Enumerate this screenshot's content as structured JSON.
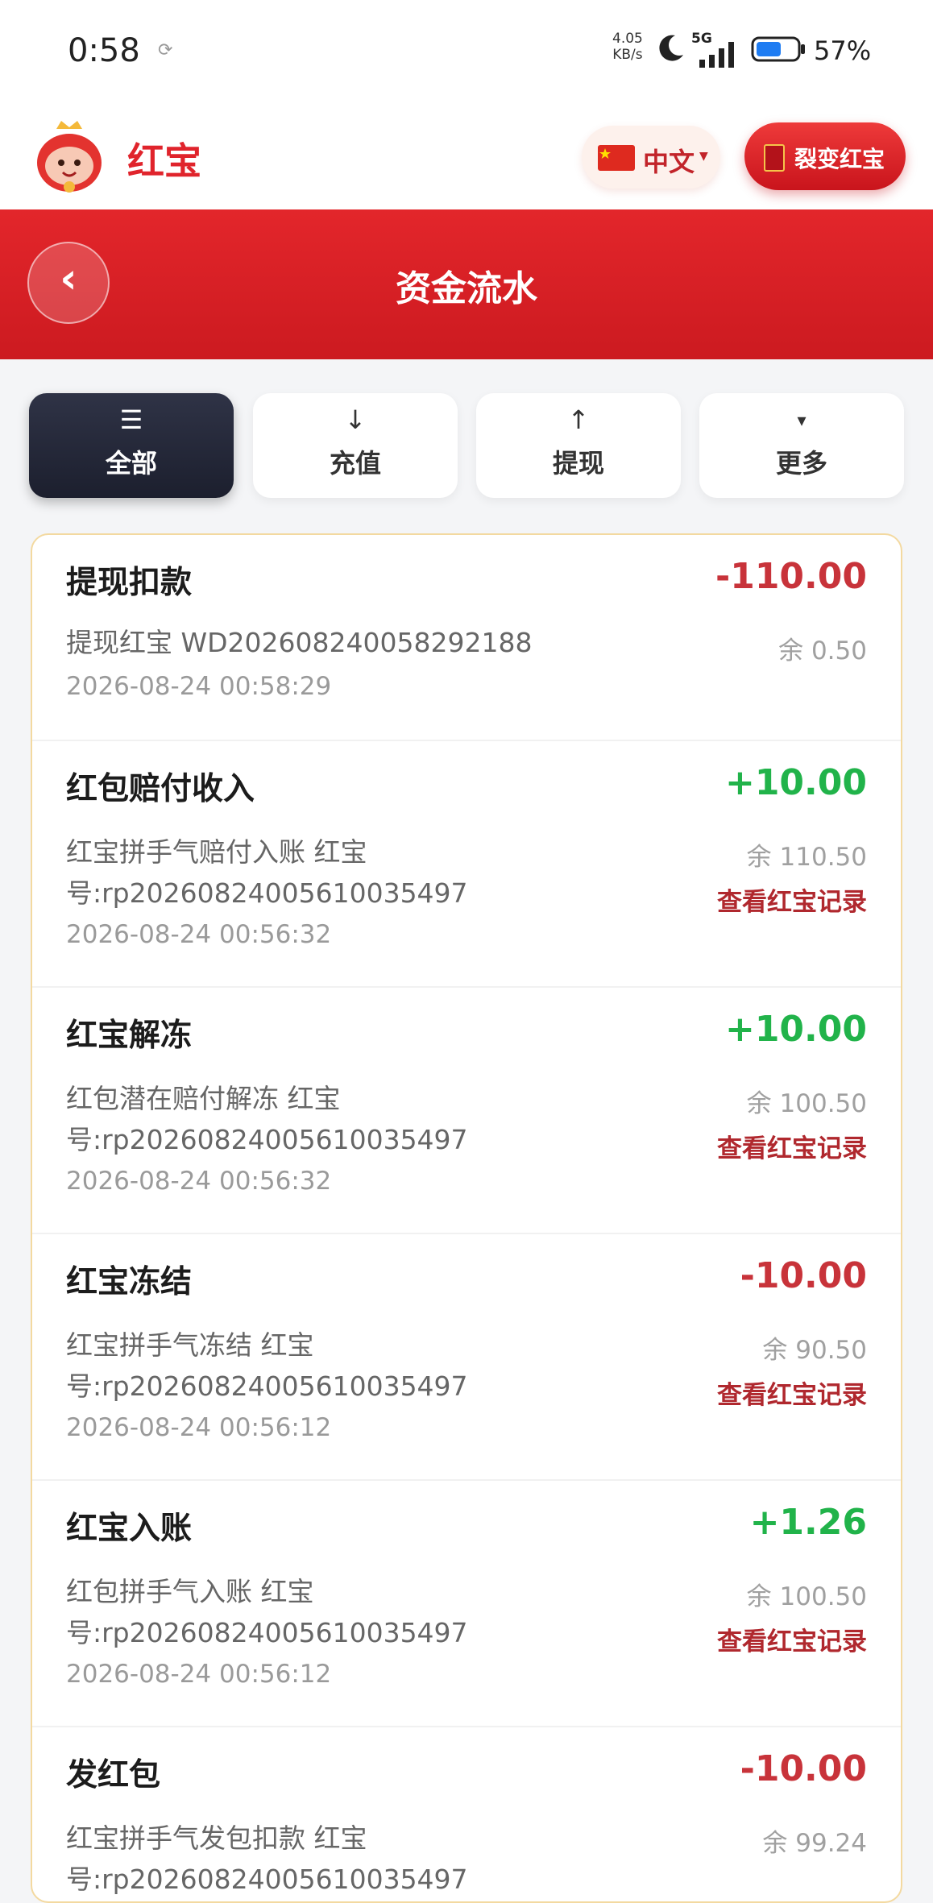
{
  "status_bar": {
    "time": "0:58",
    "net_speed_value": "4.05",
    "net_speed_unit": "KB/s",
    "network": "5G",
    "battery": "57%",
    "icons": [
      "sync-icon",
      "moon-icon",
      "signal-icon",
      "battery-icon"
    ]
  },
  "header": {
    "app_name": "红宝",
    "language": "中文",
    "fission_button": "裂变红宝"
  },
  "title_bar": {
    "back": "‹",
    "title": "资金流水"
  },
  "tabs": [
    {
      "icon": "☰",
      "label": "全部",
      "active": true
    },
    {
      "icon": "↓",
      "label": "充值",
      "active": false
    },
    {
      "icon": "↑",
      "label": "提现",
      "active": false
    },
    {
      "icon": "▾",
      "label": "更多",
      "active": false
    }
  ],
  "transactions": [
    {
      "title": "提现扣款",
      "description": "提现红宝 WD202608240058292188",
      "time": "2026-08-24 00:58:29",
      "amount": "-110.00",
      "sign": "neg",
      "balance": "余 0.50",
      "link": ""
    },
    {
      "title": "红包赔付收入",
      "description": "红宝拼手气赔付入账 红宝号:rp20260824005610035497",
      "time": "2026-08-24 00:56:32",
      "amount": "+10.00",
      "sign": "pos",
      "balance": "余 110.50",
      "link": "查看红宝记录"
    },
    {
      "title": "红宝解冻",
      "description": "红包潜在赔付解冻 红宝号:rp20260824005610035497",
      "time": "2026-08-24 00:56:32",
      "amount": "+10.00",
      "sign": "pos",
      "balance": "余 100.50",
      "link": "查看红宝记录"
    },
    {
      "title": "红宝冻结",
      "description": "红宝拼手气冻结 红宝号:rp20260824005610035497",
      "time": "2026-08-24 00:56:12",
      "amount": "-10.00",
      "sign": "neg",
      "balance": "余 90.50",
      "link": "查看红宝记录"
    },
    {
      "title": "红宝入账",
      "description": "红包拼手气入账 红宝号:rp20260824005610035497",
      "time": "2026-08-24 00:56:12",
      "amount": "+1.26",
      "sign": "pos",
      "balance": "余 100.50",
      "link": "查看红宝记录"
    },
    {
      "title": "发红包",
      "description": "红宝拼手气发包扣款 红宝号:rp20260824005610035497",
      "time": "",
      "amount": "-10.00",
      "sign": "neg",
      "balance": "余 99.24",
      "link": ""
    }
  ],
  "colors": {
    "brand_red": "#e0242c",
    "negative": "#c8333a",
    "positive": "#21b34a",
    "link": "#b0282e",
    "active_tab": "#23273a"
  }
}
